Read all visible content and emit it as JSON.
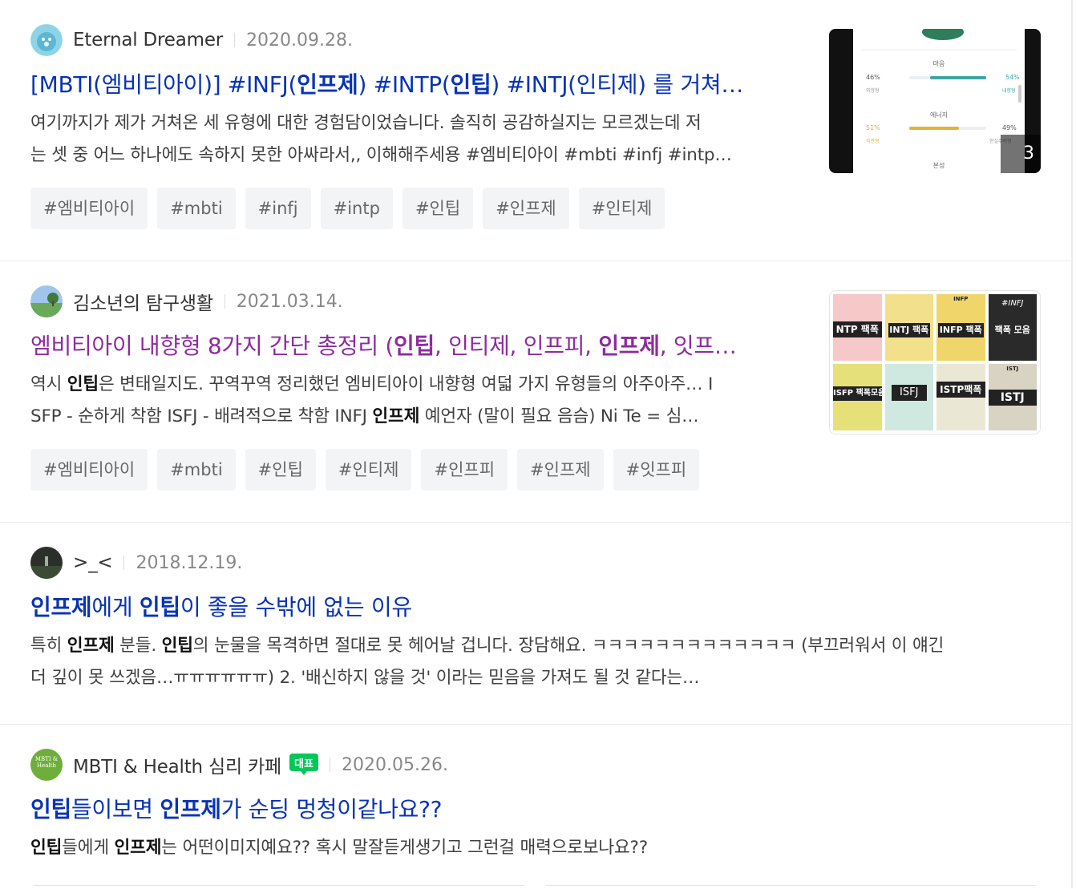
{
  "results": [
    {
      "author": "Eternal Dreamer",
      "date": "2020.09.28.",
      "title": "[MBTI(엠비티아이)] #INFJ(인프제) #INTP(인팁) #INTJ(인티제) 를 거쳐…",
      "desc_line1": "여기까지가 제가 거쳐온 세 유형에 대한 경험담이었습니다. 솔직히 공감하실지는 모르겠는데 저",
      "desc_line2": "는 셋 중 어느 하나에도 속하지 못한 아싸라서,, 이해해주세용 #엠비티아이 #mbti #infj #intp…",
      "tags": [
        "#엠비티아이",
        "#mbti",
        "#infj",
        "#intp",
        "#인팁",
        "#인프제",
        "#인티제"
      ],
      "thumb": {
        "count": "3",
        "section1": "마음",
        "pct1_left": "46%",
        "pct1_right": "54%",
        "label1_left": "외향형",
        "label1_right": "내향형",
        "section2": "에너지",
        "pct2_left": "51%",
        "pct2_right": "49%",
        "label2_left": "직관형",
        "label2_right": "현실주의형",
        "section3": "본성"
      }
    },
    {
      "author": "김소년의 탐구생활",
      "date": "2021.03.14.",
      "title": "엠비티아이 내향형 8가지 간단 총정리 (인팁, 인티제, 인프피, 인프제, 잇프…",
      "desc_line1": "역시 인팁은 변태일지도. 꾸역꾸역 정리했던 엠비티아이 내향형 여덟 가지 유형들의 아주아주… I",
      "desc_line2": "SFP - 순하게 착함 ISFJ - 배려적으로 착함 INFJ 인프제 예언자 (말이 필요 음슴) Ni Te = 심…",
      "tags": [
        "#엠비티아이",
        "#mbti",
        "#인팁",
        "#인티제",
        "#인프피",
        "#인프제",
        "#잇프피"
      ],
      "thumb_cards": [
        "NTP 팩폭",
        "INTJ 팩폭",
        "INFP 팩폭",
        "팩폭 모음",
        "ISFP 팩폭모음",
        "ISFJ",
        "ISTP팩폭",
        "ISTJ"
      ],
      "thumb_card_headers": [
        "INFP",
        "#INFJ",
        "ISTJ"
      ]
    },
    {
      "author": ">_<",
      "date": "2018.12.19.",
      "title": "인프제에게 인팁이 좋을 수밖에 없는 이유",
      "desc_line1": "특히 인프제 분들. 인팁의 눈물을 목격하면 절대로 못 헤어날 겁니다. 장담해요. ㅋㅋㅋㅋㅋㅋㅋㅋㅋㅋㅋㅋㅋ (부끄러워서 이 얘긴",
      "desc_line2": "더 깊이 못 쓰겠음…ㅠㅠㅠㅠㅠㅠ) 2. '배신하지 않을 것' 이라는 믿음을 가져도 될 것 같다는…"
    },
    {
      "author": "MBTI & Health 심리 카페",
      "badge": "대표",
      "avatar_text": "MBTI & Health",
      "date": "2020.05.26.",
      "title": "인팁들이보면 인프제가 순딩 멍청이같나요??",
      "desc_line1": "인팁들에게 인프제는 어떤이미지예요?? 혹시 말잘듣게생기고 그런걸 매력으로보나요??"
    }
  ],
  "colors": {
    "link": "#0833b5",
    "visited": "#8e2ba0",
    "badge": "#03c75a"
  }
}
